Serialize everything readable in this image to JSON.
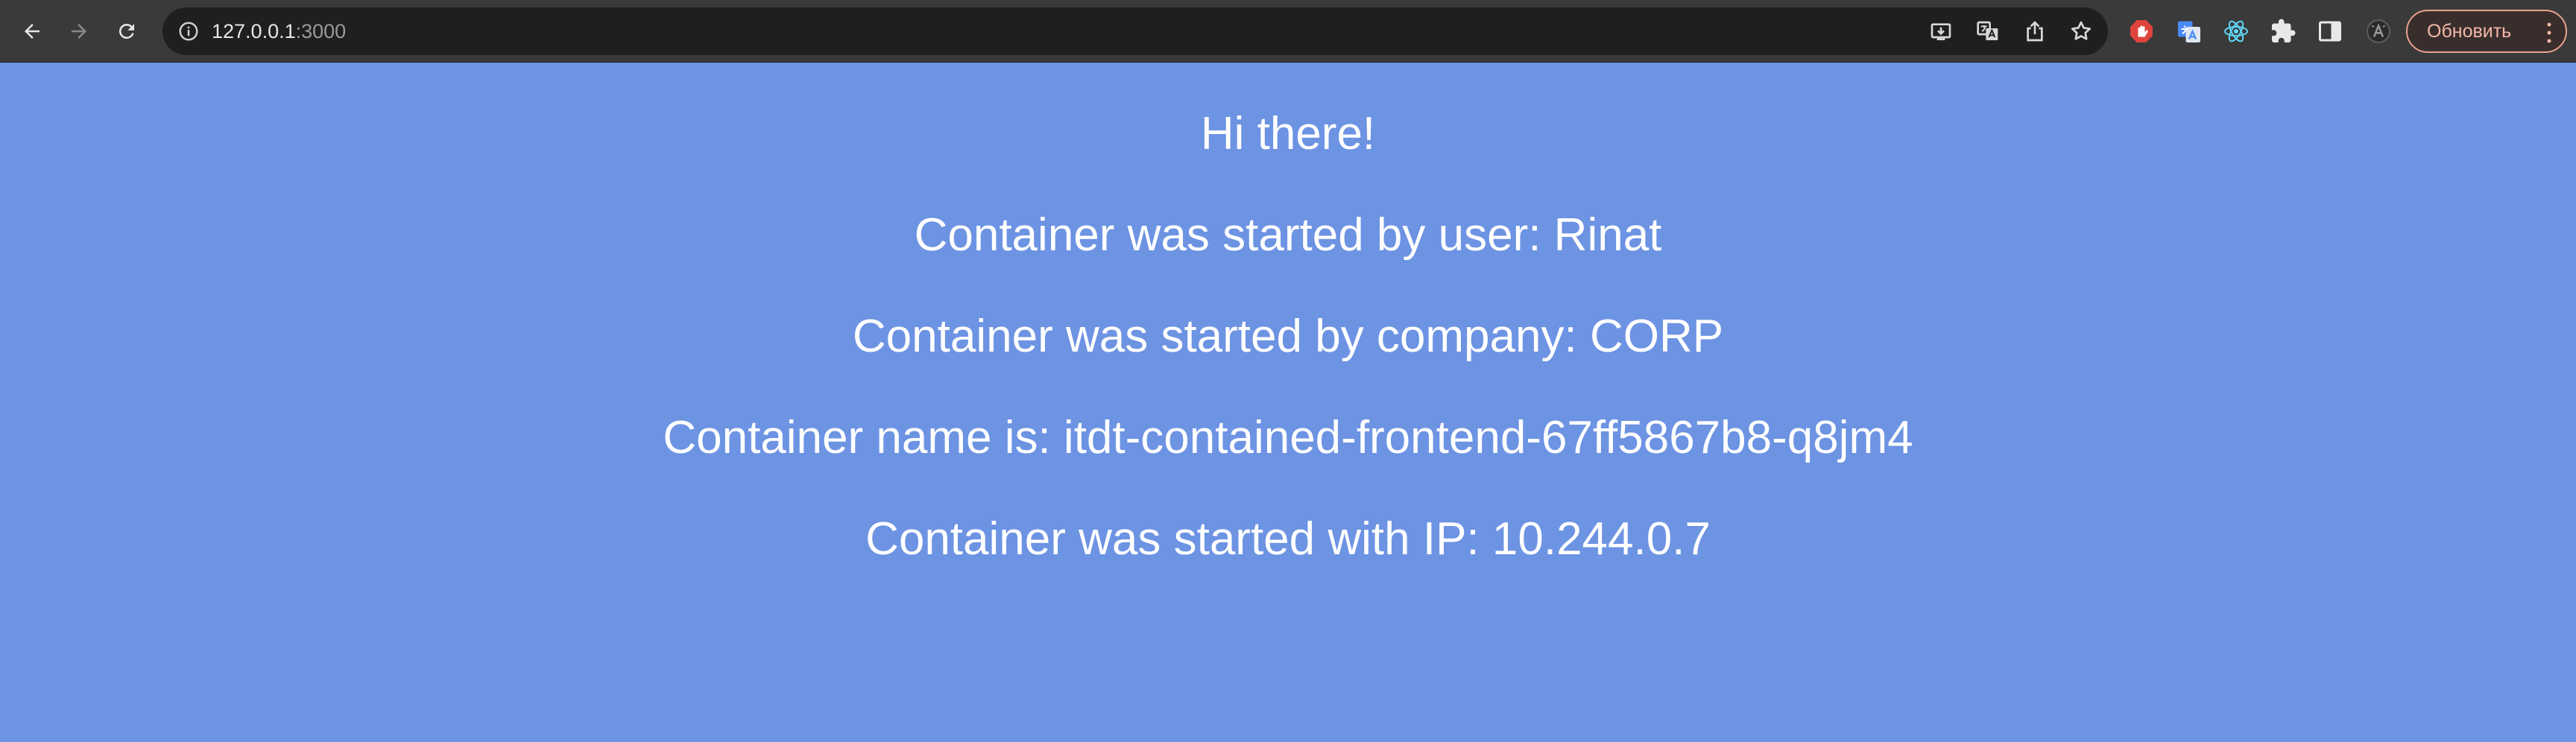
{
  "browser": {
    "url_host": "127.0.0.1",
    "url_port": ":3000",
    "update_button_label": "Обновить",
    "icons": {
      "back": "arrow-left-icon",
      "forward": "arrow-right-icon",
      "reload": "reload-icon",
      "site_info": "info-icon",
      "install": "install-app-icon",
      "translate": "translate-icon",
      "share": "share-icon",
      "bookmark": "star-icon",
      "extensions": [
        "adblock-icon",
        "google-translate-icon",
        "react-devtools-icon",
        "puzzle-extensions-icon",
        "side-panel-icon",
        "profile-icon"
      ]
    }
  },
  "page": {
    "background_color": "#6d93e3",
    "text_color": "#ffffff",
    "lines": [
      "Hi there!",
      "Container was started by user: Rinat",
      "Container was started by company: CORP",
      "Container name is: itdt-contained-frontend-67ff5867b8-q8jm4",
      "Container was started with IP: 10.244.0.7"
    ]
  }
}
